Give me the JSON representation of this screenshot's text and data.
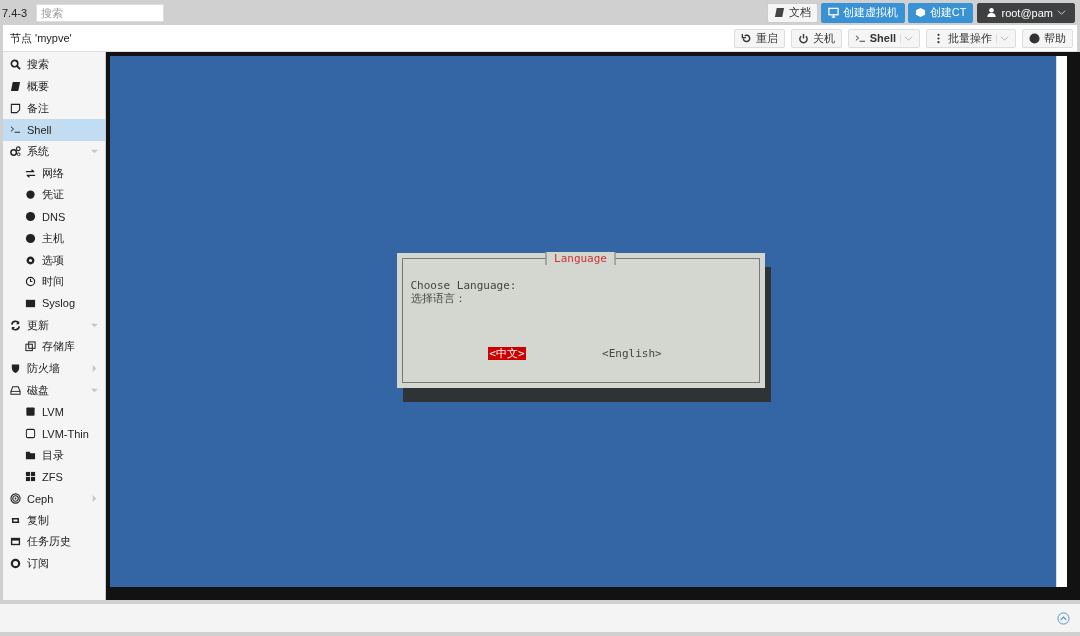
{
  "top_bar": {
    "version": "7.4-3",
    "search": {
      "placeholder": "搜索"
    },
    "buttons": [
      {
        "label": "文档",
        "kind": "plain"
      },
      {
        "label": "创建虚拟机",
        "kind": "primary"
      },
      {
        "label": "创建CT",
        "kind": "primary"
      },
      {
        "label": "root@pam",
        "kind": "user"
      }
    ]
  },
  "header": {
    "title": "节点 'mypve'",
    "buttons": [
      {
        "label": "重启",
        "menu": false
      },
      {
        "label": "关机",
        "menu": false
      },
      {
        "label": "Shell",
        "menu": true
      },
      {
        "label": "批量操作",
        "menu": true
      },
      {
        "label": "帮助",
        "menu": false
      }
    ]
  },
  "sidebar": {
    "items": [
      {
        "label": "搜索",
        "selected": false
      },
      {
        "label": "概要",
        "selected": false
      },
      {
        "label": "备注",
        "selected": false
      },
      {
        "label": "Shell",
        "selected": true
      },
      {
        "label": "系统",
        "selected": false,
        "expanded": true,
        "children": [
          {
            "label": "网络",
            "selected": false
          },
          {
            "label": "凭证",
            "selected": false
          },
          {
            "label": "DNS",
            "selected": false
          },
          {
            "label": "主机",
            "selected": false
          },
          {
            "label": "选项",
            "selected": false
          },
          {
            "label": "时间",
            "selected": false
          },
          {
            "label": "Syslog",
            "selected": false
          }
        ]
      },
      {
        "label": "更新",
        "selected": false,
        "expanded": true,
        "children": [
          {
            "label": "存储库",
            "selected": false
          }
        ]
      },
      {
        "label": "防火墙",
        "selected": false,
        "expanded": false
      },
      {
        "label": "磁盘",
        "selected": false,
        "expanded": true,
        "children": [
          {
            "label": "LVM",
            "selected": false
          },
          {
            "label": "LVM-Thin",
            "selected": false
          },
          {
            "label": "目录",
            "selected": false
          },
          {
            "label": "ZFS",
            "selected": false
          }
        ]
      },
      {
        "label": "Ceph",
        "selected": false,
        "expanded": false
      },
      {
        "label": "复制",
        "selected": false
      },
      {
        "label": "任务历史",
        "selected": false
      },
      {
        "label": "订阅",
        "selected": false
      }
    ]
  },
  "terminal": {
    "dialog": {
      "title": "Language",
      "lines": [
        "Choose Language:",
        "选择语言："
      ],
      "buttons": [
        {
          "label": "<中文>",
          "selected": true
        },
        {
          "label": "<English>",
          "selected": false
        }
      ]
    }
  }
}
